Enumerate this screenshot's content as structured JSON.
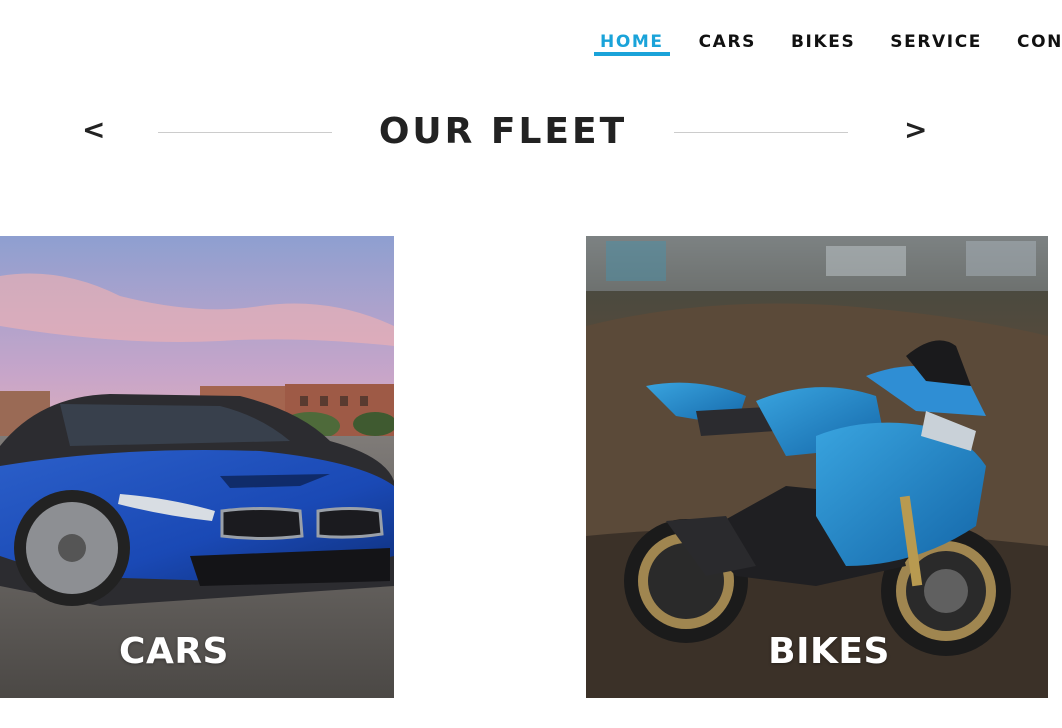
{
  "nav": {
    "items": [
      {
        "label": "HOME",
        "active": true
      },
      {
        "label": "CARS",
        "active": false
      },
      {
        "label": "BIKES",
        "active": false
      },
      {
        "label": "SERVICE",
        "active": false
      },
      {
        "label": "CON",
        "active": false
      }
    ],
    "accent_color": "#1aa3d9"
  },
  "fleet": {
    "title": "OUR FLEET",
    "prev_label": "<",
    "next_label": ">"
  },
  "cards": [
    {
      "label": "CARS",
      "icon": "car-photo"
    },
    {
      "label": "BIKES",
      "icon": "motorcycle-photo"
    }
  ]
}
